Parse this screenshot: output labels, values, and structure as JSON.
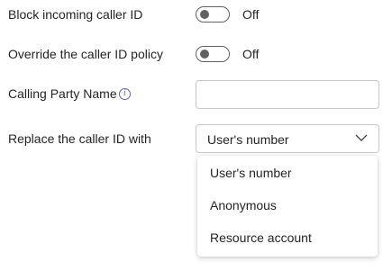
{
  "settings": {
    "block_incoming": {
      "label": "Block incoming caller ID",
      "state": "Off"
    },
    "override_policy": {
      "label": "Override the caller ID policy",
      "state": "Off"
    },
    "calling_party_name": {
      "label": "Calling Party Name",
      "value": "",
      "info_icon": "info-icon"
    },
    "replace_caller_id": {
      "label": "Replace the caller ID with",
      "selected": "User's number",
      "options": [
        "User's number",
        "Anonymous",
        "Resource account"
      ]
    }
  },
  "colors": {
    "text": "#242424",
    "toggle_off": "#616161",
    "info_icon": "#6264a7",
    "input_border": "#c7c7c7"
  }
}
